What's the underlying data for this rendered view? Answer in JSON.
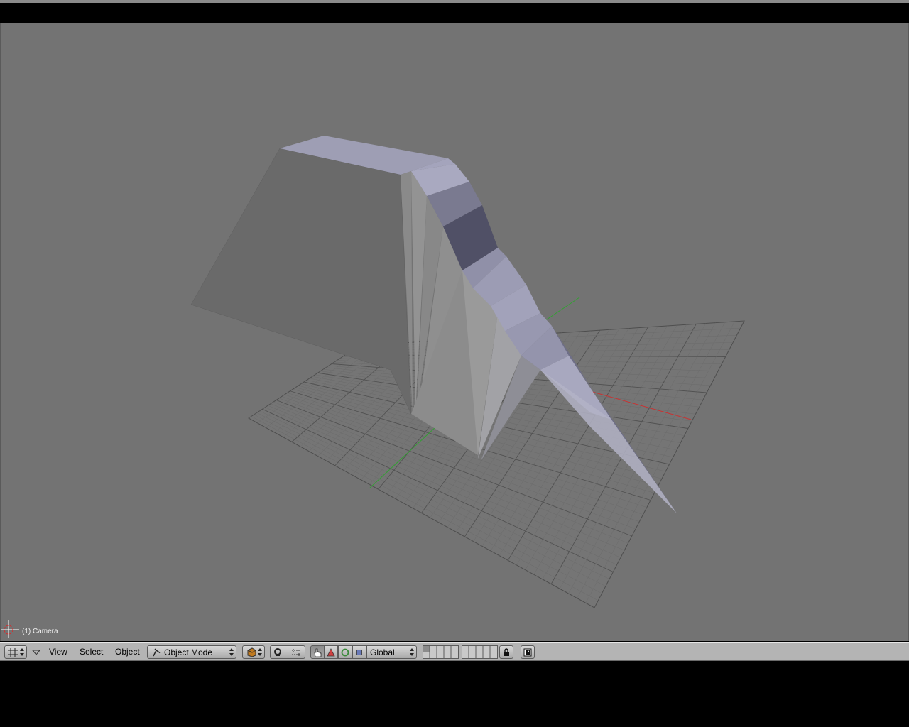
{
  "viewport": {
    "camera_label": "(1) Camera",
    "background_color": "#737373"
  },
  "header": {
    "editor_type_icon": "3d-view-grid-icon",
    "menus": {
      "view": "View",
      "select": "Select",
      "object": "Object"
    },
    "mode": "Object Mode",
    "draw_type_icon": "solid-cube-icon",
    "pivot_icon": "pivot-icon",
    "manipulator": {
      "hand_icon": "hand-icon",
      "translate_icon": "triangle-icon",
      "rotate_icon": "ring-icon",
      "scale_icon": "square-icon"
    },
    "orientation": "Global",
    "lock_icon": "lock-icon",
    "render_icon": "render-icon"
  },
  "colors": {
    "header_bg": "#b4b4b4",
    "mesh_light": "#9a9ab4",
    "x_axis": "#c83232",
    "y_axis": "#32a032"
  }
}
